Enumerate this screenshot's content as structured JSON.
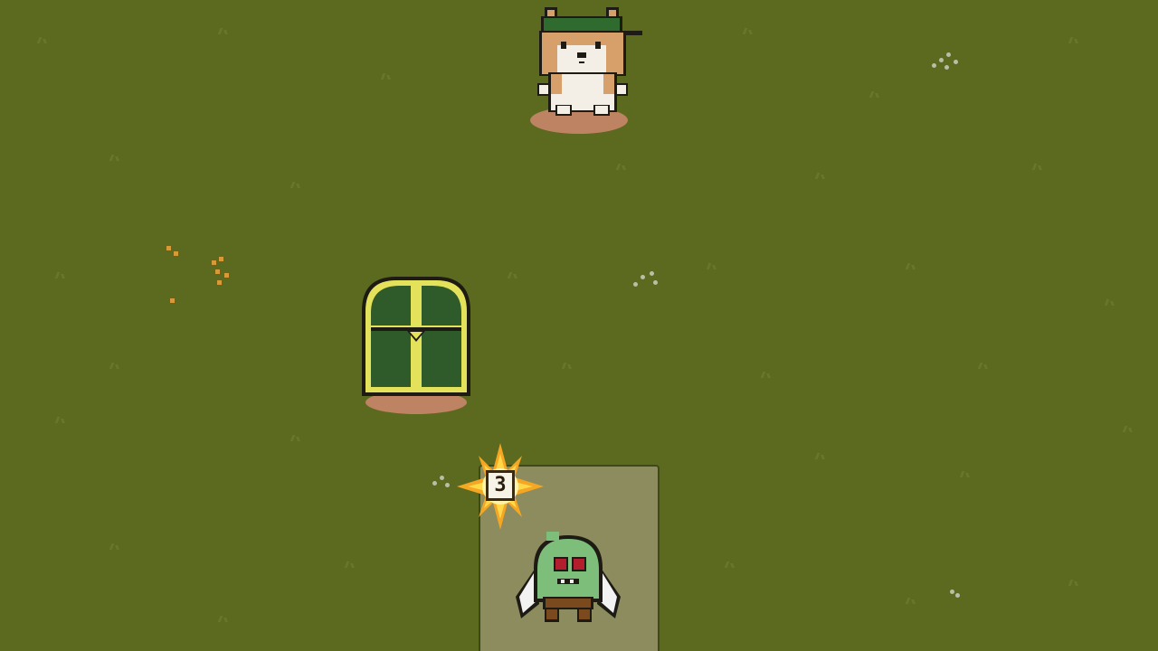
{
  "scene": {
    "background_color": "#5b6a1e",
    "tile_color": "#8c8c5e"
  },
  "enemies": [
    {
      "name": "shiba-dog",
      "icon": "dog-icon",
      "hat": "green-cap"
    }
  ],
  "objects": [
    {
      "name": "treasure-chest",
      "icon": "chest-icon",
      "color": "#2f5a2a",
      "trim_color": "#e3e25a"
    }
  ],
  "player": {
    "name": "green-blob",
    "icon": "player-icon"
  },
  "counter": {
    "value": "3",
    "icon": "burst-icon",
    "color": "#f5a623"
  }
}
